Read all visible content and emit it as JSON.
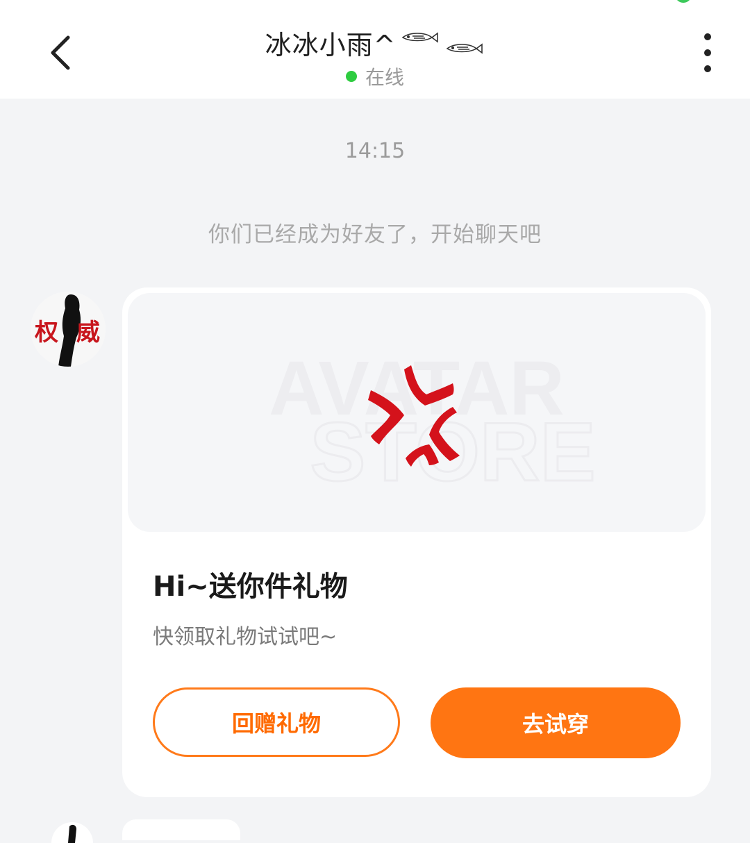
{
  "header": {
    "title": "冰冰小雨^",
    "status": "在线",
    "fish_icon": "fish-decoration-icon",
    "back_icon": "chevron-left-icon",
    "more_icon": "more-vertical-icon",
    "online_color": "#2ecc40"
  },
  "chat": {
    "timestamp": "14:15",
    "system_message": "你们已经成为好友了，开始聊天吧"
  },
  "gift_card": {
    "image_watermark_line1": "AVATAR",
    "image_watermark_line2": "STORE",
    "title": "Hi~送你件礼物",
    "description": "快领取礼物试试吧~",
    "return_gift_label": "回赠礼物",
    "try_on_label": "去试穿",
    "accent_color": "#ff7512"
  },
  "avatar": {
    "text": "权 威"
  }
}
